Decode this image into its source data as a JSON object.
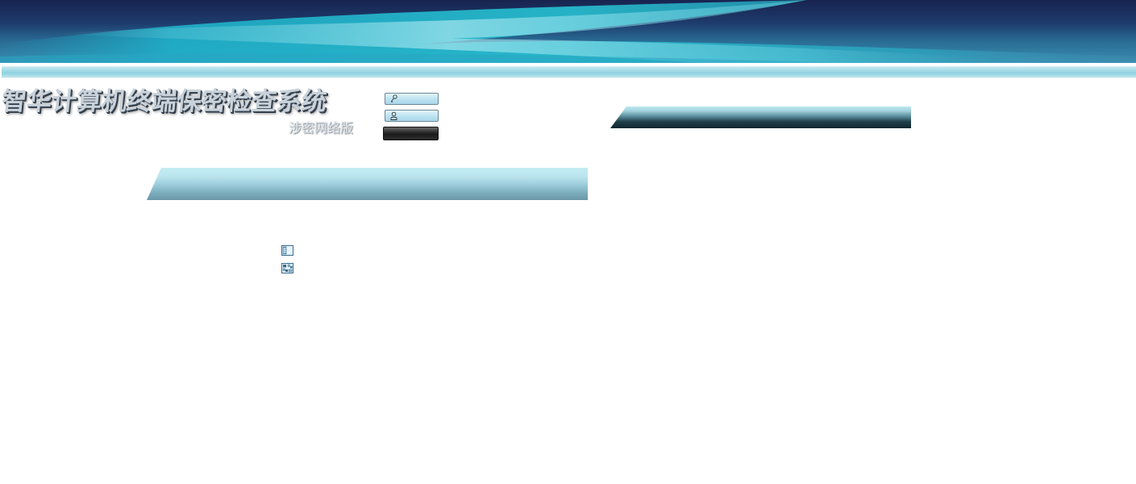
{
  "app": {
    "title": "智华计算机终端保密检查系统",
    "subtitle": "涉密网络版"
  },
  "login": {
    "password_icon": "key-icon",
    "username_icon": "user-icon",
    "password_value": "",
    "username_value": "",
    "submit_label": ""
  },
  "panels": {
    "left_header": "",
    "right_header": ""
  },
  "links": [
    {
      "icon": "window-layout-icon",
      "label": ""
    },
    {
      "icon": "grid-layout-icon",
      "label": ""
    }
  ],
  "colors": {
    "banner_dark": "#18244f",
    "banner_teal": "#2bb3c9",
    "bar_light": "#c3ecf3",
    "bar_dark": "#0f2630"
  }
}
